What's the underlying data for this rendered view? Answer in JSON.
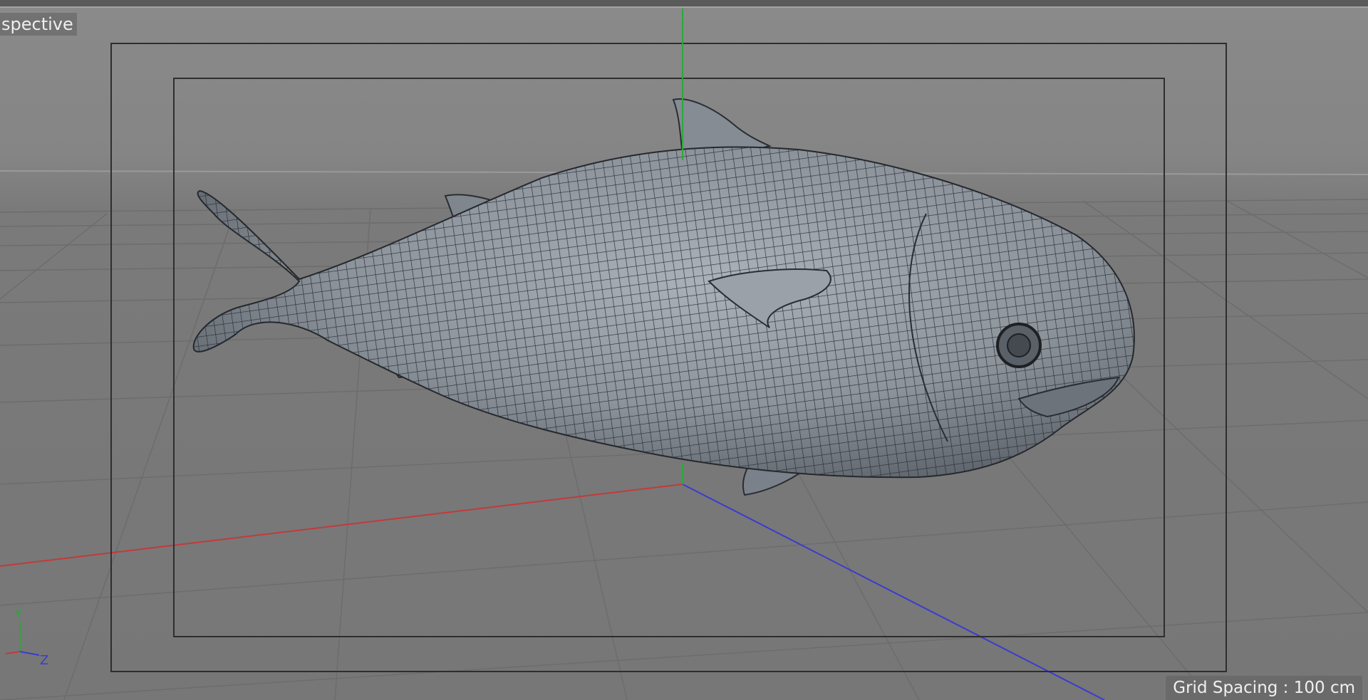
{
  "viewport": {
    "label": "spective",
    "grid_spacing": "Grid Spacing : 100 cm"
  },
  "axis_gizmo": {
    "y_label": "Y",
    "z_label": "Z"
  },
  "colors": {
    "background": "#7a7a7a",
    "grid_line": "#6a6a6a",
    "x_axis": "#c23a3a",
    "y_axis": "#2ea63a",
    "z_axis": "#3b3bd0",
    "safe_frame": "#2e2e2e",
    "mesh_fill": "#8f969e",
    "wireframe": "#2a2d33"
  }
}
